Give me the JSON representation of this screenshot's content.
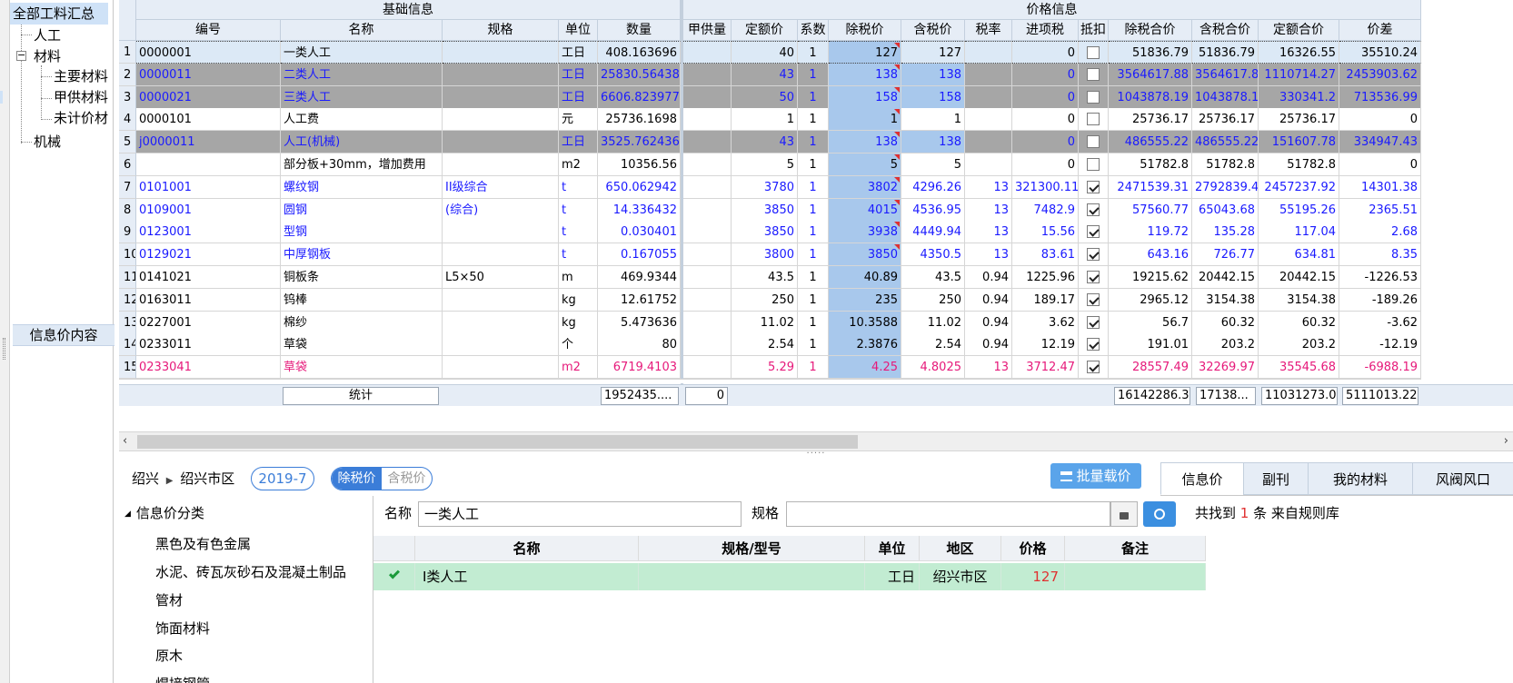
{
  "tree": {
    "items": [
      {
        "label": "全部工料汇总",
        "selected": true
      },
      {
        "label": "人工"
      },
      {
        "label": "材料",
        "expander": "−"
      },
      {
        "label": "主要材料"
      },
      {
        "label": "甲供材料"
      },
      {
        "label": "未计价材"
      },
      {
        "label": "机械"
      }
    ],
    "info_header": "信息价内容"
  },
  "grid": {
    "groups": {
      "basic": "基础信息",
      "price": "价格信息"
    },
    "columns": [
      "编号",
      "名称",
      "规格",
      "单位",
      "数量",
      "甲供量",
      "定额价",
      "系数",
      "除税价",
      "含税价",
      "税率",
      "进项税",
      "抵扣",
      "除税合价",
      "含税合价",
      "定额合价",
      "价差"
    ],
    "rows": [
      {
        "no": "1",
        "code": "0000001",
        "name": "一类人工",
        "spec": "",
        "unit": "工日",
        "qty": "408.163696",
        "supply": "",
        "quota": "40",
        "coef": "1",
        "exTax": "127",
        "inTax": "127",
        "rate": "",
        "inputTax": "0",
        "deduct": false,
        "exTaxTotal": "51836.79",
        "inTaxTotal": "51836.79",
        "quotaTotal": "16326.55",
        "diff": "35510.24",
        "style": "selected"
      },
      {
        "no": "2",
        "code": "0000011",
        "name": "二类人工",
        "spec": "",
        "unit": "工日",
        "qty": "25830.564383",
        "supply": "",
        "quota": "43",
        "coef": "1",
        "exTax": "138",
        "inTax": "138",
        "rate": "",
        "inputTax": "0",
        "deduct": false,
        "exTaxTotal": "3564617.88",
        "inTaxTotal": "3564617.8",
        "quotaTotal": "1110714.27",
        "diff": "2453903.62",
        "style": "gray"
      },
      {
        "no": "3",
        "code": "0000021",
        "name": "三类人工",
        "spec": "",
        "unit": "工日",
        "qty": "6606.823977",
        "supply": "",
        "quota": "50",
        "coef": "1",
        "exTax": "158",
        "inTax": "158",
        "rate": "",
        "inputTax": "0",
        "deduct": false,
        "exTaxTotal": "1043878.19",
        "inTaxTotal": "1043878.1",
        "quotaTotal": "330341.2",
        "diff": "713536.99",
        "style": "gray"
      },
      {
        "no": "4",
        "code": "0000101",
        "name": "人工费",
        "spec": "",
        "unit": "元",
        "qty": "25736.1698",
        "supply": "",
        "quota": "1",
        "coef": "1",
        "exTax": "1",
        "inTax": "1",
        "rate": "",
        "inputTax": "0",
        "deduct": false,
        "exTaxTotal": "25736.17",
        "inTaxTotal": "25736.17",
        "quotaTotal": "25736.17",
        "diff": "0",
        "style": "normal"
      },
      {
        "no": "5",
        "code": "j0000011",
        "name": "人工(机械)",
        "spec": "",
        "unit": "工日",
        "qty": "3525.762436",
        "supply": "",
        "quota": "43",
        "coef": "1",
        "exTax": "138",
        "inTax": "138",
        "rate": "",
        "inputTax": "0",
        "deduct": false,
        "exTaxTotal": "486555.22",
        "inTaxTotal": "486555.22",
        "quotaTotal": "151607.78",
        "diff": "334947.43",
        "style": "gray"
      },
      {
        "no": "6",
        "code": "",
        "name": "部分板+30mm，增加费用",
        "spec": "",
        "unit": "m2",
        "qty": "10356.56",
        "supply": "",
        "quota": "5",
        "coef": "1",
        "exTax": "5",
        "inTax": "5",
        "rate": "",
        "inputTax": "0",
        "deduct": false,
        "exTaxTotal": "51782.8",
        "inTaxTotal": "51782.8",
        "quotaTotal": "51782.8",
        "diff": "0",
        "style": "normal"
      },
      {
        "no": "7",
        "code": "0101001",
        "name": "螺纹钢",
        "spec": "II级综合",
        "unit": "t",
        "qty": "650.062942",
        "supply": "",
        "quota": "3780",
        "coef": "1",
        "exTax": "3802",
        "inTax": "4296.26",
        "rate": "13",
        "inputTax": "321300.11",
        "deduct": true,
        "exTaxTotal": "2471539.31",
        "inTaxTotal": "2792839.4",
        "quotaTotal": "2457237.92",
        "diff": "14301.38",
        "style": "blue"
      },
      {
        "no": "8",
        "code": "0109001",
        "name": "圆钢",
        "spec": "(综合)",
        "unit": "t",
        "qty": "14.336432",
        "supply": "",
        "quota": "3850",
        "coef": "1",
        "exTax": "4015",
        "inTax": "4536.95",
        "rate": "13",
        "inputTax": "7482.9",
        "deduct": true,
        "exTaxTotal": "57560.77",
        "inTaxTotal": "65043.68",
        "quotaTotal": "55195.26",
        "diff": "2365.51",
        "style": "blue"
      },
      {
        "no": "9",
        "code": "0123001",
        "name": "型钢",
        "spec": "",
        "unit": "t",
        "qty": "0.030401",
        "supply": "",
        "quota": "3850",
        "coef": "1",
        "exTax": "3938",
        "inTax": "4449.94",
        "rate": "13",
        "inputTax": "15.56",
        "deduct": true,
        "exTaxTotal": "119.72",
        "inTaxTotal": "135.28",
        "quotaTotal": "117.04",
        "diff": "2.68",
        "style": "blue"
      },
      {
        "no": "10",
        "code": "0129021",
        "name": "中厚钢板",
        "spec": "",
        "unit": "t",
        "qty": "0.167055",
        "supply": "",
        "quota": "3800",
        "coef": "1",
        "exTax": "3850",
        "inTax": "4350.5",
        "rate": "13",
        "inputTax": "83.61",
        "deduct": true,
        "exTaxTotal": "643.16",
        "inTaxTotal": "726.77",
        "quotaTotal": "634.81",
        "diff": "8.35",
        "style": "blue"
      },
      {
        "no": "11",
        "code": "0141021",
        "name": "铜板条",
        "spec": "L5×50",
        "unit": "m",
        "qty": "469.9344",
        "supply": "",
        "quota": "43.5",
        "coef": "1",
        "exTax": "40.89",
        "inTax": "43.5",
        "rate": "0.94",
        "inputTax": "1225.96",
        "deduct": true,
        "exTaxTotal": "19215.62",
        "inTaxTotal": "20442.15",
        "quotaTotal": "20442.15",
        "diff": "-1226.53",
        "style": "normal"
      },
      {
        "no": "12",
        "code": "0163011",
        "name": "钨棒",
        "spec": "",
        "unit": "kg",
        "qty": "12.61752",
        "supply": "",
        "quota": "250",
        "coef": "1",
        "exTax": "235",
        "inTax": "250",
        "rate": "0.94",
        "inputTax": "189.17",
        "deduct": true,
        "exTaxTotal": "2965.12",
        "inTaxTotal": "3154.38",
        "quotaTotal": "3154.38",
        "diff": "-189.26",
        "style": "normal"
      },
      {
        "no": "13",
        "code": "0227001",
        "name": "棉纱",
        "spec": "",
        "unit": "kg",
        "qty": "5.473636",
        "supply": "",
        "quota": "11.02",
        "coef": "1",
        "exTax": "10.3588",
        "inTax": "11.02",
        "rate": "0.94",
        "inputTax": "3.62",
        "deduct": true,
        "exTaxTotal": "56.7",
        "inTaxTotal": "60.32",
        "quotaTotal": "60.32",
        "diff": "-3.62",
        "style": "normal"
      },
      {
        "no": "14",
        "code": "0233011",
        "name": "草袋",
        "spec": "",
        "unit": "个",
        "qty": "80",
        "supply": "",
        "quota": "2.54",
        "coef": "1",
        "exTax": "2.3876",
        "inTax": "2.54",
        "rate": "0.94",
        "inputTax": "12.19",
        "deduct": true,
        "exTaxTotal": "191.01",
        "inTaxTotal": "203.2",
        "quotaTotal": "203.2",
        "diff": "-12.19",
        "style": "normal"
      },
      {
        "no": "15",
        "code": "0233041",
        "name": "草袋",
        "spec": "",
        "unit": "m2",
        "qty": "6719.4103",
        "supply": "",
        "quota": "5.29",
        "coef": "1",
        "exTax": "4.25",
        "inTax": "4.8025",
        "rate": "13",
        "inputTax": "3712.47",
        "deduct": true,
        "exTaxTotal": "28557.49",
        "inTaxTotal": "32269.97",
        "quotaTotal": "35545.68",
        "diff": "-6988.19",
        "style": "pink"
      }
    ],
    "summary": {
      "label": "统计",
      "qty": "1952435....",
      "supply": "0",
      "exTaxTotal": "16142286.32",
      "inTaxTotal": "17138...",
      "quotaTotal": "11031273.08",
      "diff": "5111013.22"
    },
    "colors": {
      "blue": "#1a1aff",
      "pink": "#e6197a",
      "gray_row": "#a6a6a6",
      "selected_row": "#dce9f6",
      "price_col": "#a8c8ec"
    }
  },
  "bottom": {
    "region": "绍兴",
    "subregion": "绍兴市区",
    "period": "2019-7",
    "toggle": {
      "on": "除税价",
      "off": "含税价"
    },
    "batch_button": "批量载价",
    "tabs": [
      "信息价",
      "副刊",
      "我的材料",
      "风阀风口"
    ],
    "categories_title": "信息价分类",
    "categories": [
      "黑色及有色金属",
      "水泥、砖瓦灰砂石及混凝土制品",
      "管材",
      "饰面材料",
      "原木",
      "焊接钢管"
    ],
    "search": {
      "name_label": "名称",
      "name_value": "一类人工",
      "spec_label": "规格",
      "spec_value": "",
      "found_prefix": "共找到",
      "found_count": "1",
      "found_suffix": "条 来自规则库"
    },
    "results": {
      "headers": [
        "名称",
        "规格/型号",
        "单位",
        "地区",
        "价格",
        "备注"
      ],
      "rows": [
        {
          "name": "I类人工",
          "spec": "",
          "unit": "工日",
          "region": "绍兴市区",
          "price": "127",
          "note": ""
        }
      ]
    }
  }
}
